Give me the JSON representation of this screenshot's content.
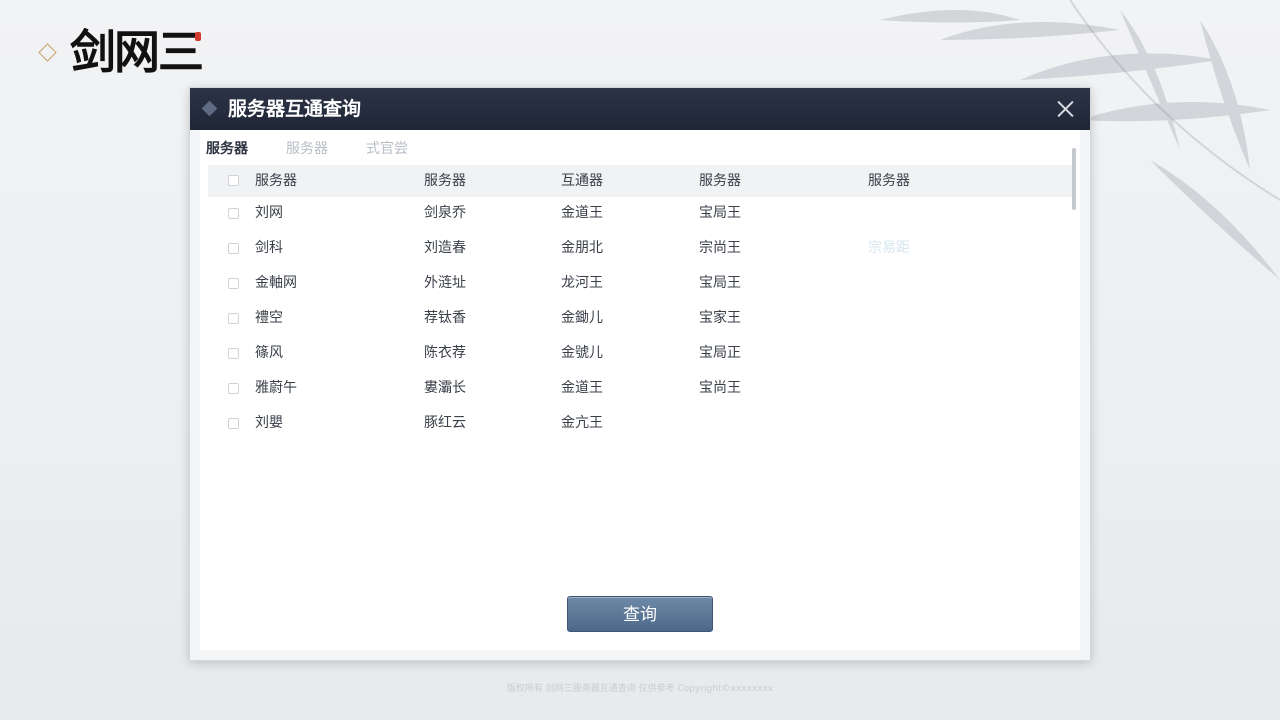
{
  "logo": {
    "text": "剑网三"
  },
  "dialog": {
    "title": "服务器互通查询",
    "tabs": [
      {
        "label": "服务器",
        "active": true
      },
      {
        "label": "服务器",
        "active": false
      },
      {
        "label": "式官尝",
        "active": false
      }
    ],
    "columns": [
      "服务器",
      "服务器",
      "互通器",
      "服务器",
      "服务器"
    ],
    "rows": [
      [
        "刘网",
        "剑泉乔",
        "金道王",
        "宝局王",
        ""
      ],
      [
        "剑科",
        "刘造春",
        "金朋北",
        "宗尚王",
        "宗易距"
      ],
      [
        "金軸网",
        "外涟址",
        "龙河王",
        "宝局王",
        ""
      ],
      [
        "禮空",
        "荐钛香",
        "金鋤儿",
        "宝家王",
        ""
      ],
      [
        "篠风",
        "陈衣荐",
        "金號儿",
        "宝局正",
        ""
      ],
      [
        "雅蔚午",
        "婁灞长",
        "金道王",
        "宝尚王",
        ""
      ],
      [
        "刘嬰",
        "豚红云",
        "金亢王",
        "",
        ""
      ]
    ],
    "query_button": "查询"
  },
  "footer": {
    "text": "版权所有 剑网三服务器互通查询 仅供参考 Copyright©xxxxxxxx"
  },
  "colors": {
    "titlebar": "#232a3b",
    "button": "#5a7495",
    "accent_seal": "#d03a2f",
    "diamond": "#c8a46d"
  }
}
